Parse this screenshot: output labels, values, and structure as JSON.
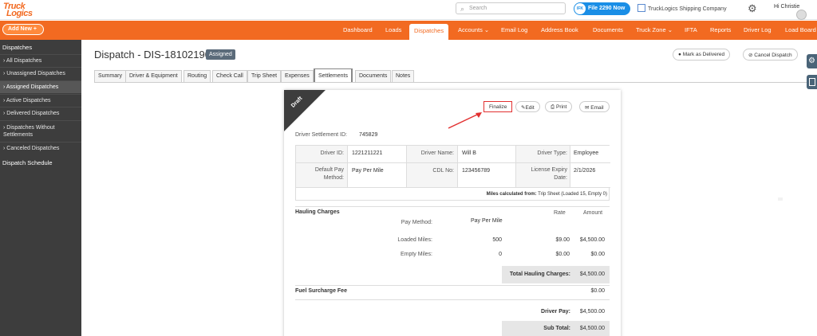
{
  "header": {
    "logo_line1": "Truck",
    "logo_line2": "Logics",
    "search_placeholder": "Search",
    "file2290_badge": "IFK",
    "file2290_label": "File 2290 Now",
    "company_name": "TruckLogics Shipping Company",
    "greeting": "Hi Christie"
  },
  "nav": {
    "add_new": "Add New  +",
    "items": [
      "Dashboard",
      "Loads",
      "Dispatches",
      "Accounts ⌄",
      "Email Log",
      "Address Book",
      "Documents",
      "Truck Zone ⌄",
      "IFTA",
      "Reports",
      "Driver Log",
      "Load Board"
    ]
  },
  "sidebar": {
    "header": "Dispatches",
    "items": [
      "All Dispatches",
      "Unassigned Dispatches",
      "Assigned Dispatches",
      "Active Dispatches",
      "Delivered Dispatches",
      "Dispatches Without Settlements",
      "Canceled Dispatches"
    ],
    "footer": "Dispatch Schedule"
  },
  "page": {
    "title": "Dispatch - DIS-18102190",
    "status_badge": "Assigned",
    "mark_delivered": "Mark as Delivered",
    "cancel_dispatch": "Cancel Dispatch",
    "tabs": [
      "Summary",
      "Driver & Equipment",
      "Routing",
      "Check Call",
      "Trip Sheet",
      "Expenses",
      "Settlements",
      "Documents",
      "Notes"
    ]
  },
  "settlement": {
    "ribbon": "Draft",
    "buttons": {
      "finalize": "Finalize",
      "edit": "Edit",
      "print": "Print",
      "email": "Email"
    },
    "settlement_id_label": "Driver Settlement ID:",
    "settlement_id": "745829",
    "driver_id_label": "Driver ID:",
    "driver_id": "1221211221",
    "driver_name_label": "Driver Name:",
    "driver_name": "Will B",
    "driver_type_label": "Driver Type:",
    "driver_type": "Employee",
    "pay_method_label_1": "Default Pay",
    "pay_method_label_2": "Method:",
    "pay_method": "Pay Per Mile",
    "cdl_label": "CDL No:",
    "cdl": "123456789",
    "license_label_1": "License Expiry",
    "license_label_2": "Date:",
    "license_expiry": "2/1/2026",
    "miles_calc_label": "Miles calculated from:",
    "miles_calc_value": "Trip Sheet (Loaded 15, Empty 0)",
    "hauling_header": "Hauling Charges",
    "col_rate": "Rate",
    "col_amount": "Amount",
    "pay_method_row_label": "Pay Method:",
    "pay_method_row_value": "Pay Per Mile",
    "loaded_label": "Loaded Miles:",
    "loaded_miles": "500",
    "loaded_rate": "$9.00",
    "loaded_amount": "$4,500.00",
    "empty_label": "Empty Miles:",
    "empty_miles": "0",
    "empty_rate": "$0.00",
    "empty_amount": "$0.00",
    "total_hauling_label": "Total Hauling Charges:",
    "total_hauling": "$4,500.00",
    "fuel_label": "Fuel Surcharge Fee",
    "fuel_amount": "$0.00",
    "driver_pay_label": "Driver Pay:",
    "driver_pay": "$4,500.00",
    "subtotal_label": "Sub Total:",
    "subtotal": "$4,500.00"
  },
  "colors": {
    "brand_orange": "#f26a21",
    "sidebar": "#3d3d3d",
    "annotation_red": "#e23030"
  }
}
